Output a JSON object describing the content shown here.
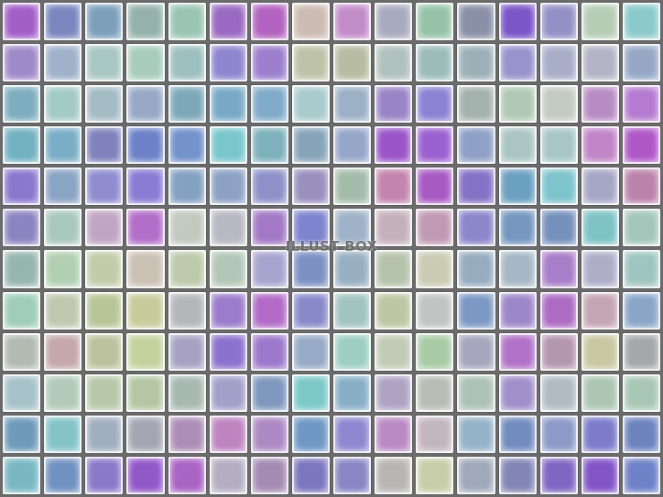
{
  "watermark": "ILLUST BOX",
  "tiles": [
    [
      "#a35fc8",
      "#7a86bd",
      "#7e9fbc",
      "#94b1aa",
      "#9ac5b2",
      "#9a6ac2",
      "#b262c0",
      "#cdbcb4",
      "#c28cc8",
      "#a8aabf",
      "#96c3a8",
      "#8a90a8",
      "#7b56c8",
      "#9390c6",
      "#b5ccb5",
      "#8bcaca"
    ],
    [
      "#a089c9",
      "#a0b1c9",
      "#a8c6c2",
      "#a8ccbe",
      "#9dbfbf",
      "#8f86d0",
      "#9d7fce",
      "#bec3a8",
      "#b8bca2",
      "#b1c1bd",
      "#9cbcb9",
      "#9cb0b8",
      "#9893cc",
      "#a8aec8",
      "#b4b3c5",
      "#96a8c6"
    ],
    [
      "#7daebf",
      "#a3cbc4",
      "#a4bcc4",
      "#98a9c8",
      "#7ea8ba",
      "#7aa9c7",
      "#80abc9",
      "#a8cbcd",
      "#9cb0c6",
      "#9a84c6",
      "#8c82d4",
      "#a4b2ad",
      "#b0c9b4",
      "#c4cbc0",
      "#b98bc5",
      "#b57bd2"
    ],
    [
      "#72b1c0",
      "#7aaec6",
      "#7f82bb",
      "#6e82c8",
      "#7492cc",
      "#79c7cc",
      "#7eb1bb",
      "#88a4b9",
      "#96a6c9",
      "#9b55c8",
      "#9c61d1",
      "#8ea0c6",
      "#aac5c3",
      "#a8c6c7",
      "#c185c8",
      "#b058c8"
    ],
    [
      "#8a78cf",
      "#8aa4c4",
      "#8f8cd0",
      "#8a7cd4",
      "#84a1c2",
      "#8ca1c4",
      "#8e91c8",
      "#9a8fbd",
      "#a5bcab",
      "#c384ae",
      "#a85ac3",
      "#8372c6",
      "#6ca0c1",
      "#7ec4cd",
      "#a6a6c6",
      "#bb83aa"
    ],
    [
      "#8c84c0",
      "#a8c7bd",
      "#c0a6c3",
      "#b36ec9",
      "#c2c9bf",
      "#b8b8c2",
      "#a379c6",
      "#7f84ce",
      "#9fb2c7",
      "#c5b1bc",
      "#c09ab4",
      "#8c86cb",
      "#7597c0",
      "#7690bc",
      "#7ec3c6",
      "#a3c6ba"
    ],
    [
      "#97b5af",
      "#b2cfb2",
      "#c2ccab",
      "#cbc0b4",
      "#bcc9aa",
      "#b3c7b8",
      "#a8a4cf",
      "#7d92c3",
      "#99b0c2",
      "#b6c3ac",
      "#c9ccb3",
      "#96adc0",
      "#a6b8c5",
      "#a97ec9",
      "#aeaec9",
      "#9fc5bf"
    ],
    [
      "#9fcdba",
      "#c0c8b0",
      "#b8c596",
      "#c6cc9b",
      "#b4b6ba",
      "#9b7bcb",
      "#b26bc7",
      "#8a8acb",
      "#a1c4c0",
      "#bec6a4",
      "#c2c4c3",
      "#7c98c5",
      "#9d87c9",
      "#ad6cc3",
      "#c4a5b4",
      "#8aa6c7"
    ],
    [
      "#b2bab2",
      "#c5a8ab",
      "#bcc29c",
      "#c4d29e",
      "#a7a2c2",
      "#8b72cf",
      "#9d79cc",
      "#97aac6",
      "#9ccfbf",
      "#c2cbb6",
      "#a8cba5",
      "#a5a5bd",
      "#b072c8",
      "#b596b0",
      "#c8c8a2",
      "#a4a8a8"
    ],
    [
      "#a6c2c8",
      "#b3cab9",
      "#b7c8a8",
      "#b5c6a4",
      "#a8b9b2",
      "#a3a0c9",
      "#7f98be",
      "#7dc8c9",
      "#88afc6",
      "#afa3c4",
      "#b8bcb3",
      "#acc2b9",
      "#a08fca",
      "#b0bbc2",
      "#acc6b3",
      "#a9c7b6"
    ],
    [
      "#6e9bb9",
      "#84c3c8",
      "#a0aec0",
      "#a4a7b3",
      "#ad8db6",
      "#bd84bf",
      "#ad89c3",
      "#6f98c4",
      "#9087d1",
      "#b98ac3",
      "#c2b6be",
      "#94b3c8",
      "#728cbf",
      "#8d9ac8",
      "#7c7ccb",
      "#6d84bf"
    ],
    [
      "#7ab7c3",
      "#7191c0",
      "#8979c9",
      "#9158c8",
      "#aa64c4",
      "#b3aec2",
      "#a48bb3",
      "#7b76be",
      "#8886c4",
      "#b8b6b4",
      "#c7cda6",
      "#a0a9b9",
      "#8386b5",
      "#8066c2",
      "#8254c6",
      "#6f82c8"
    ]
  ]
}
